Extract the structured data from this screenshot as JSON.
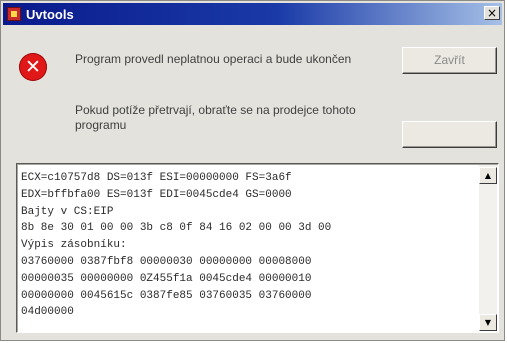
{
  "window": {
    "title": "Uvtools",
    "close_glyph": "×",
    "icon": "app-icon"
  },
  "message": {
    "line1": "Program provedl neplatnou operaci a bude ukončen",
    "line2": "Pokud potíže přetrvají, obraťte se na prodejce tohoto programu",
    "icon": "error-icon",
    "icon_glyph": "✕",
    "icon_color": "#e01818"
  },
  "buttons": {
    "close_label": "Zavřít",
    "details_label": ""
  },
  "details": {
    "lines": [
      "ECX=c10757d8 DS=013f ESI=00000000 FS=3a6f",
      "EDX=bffbfa00 ES=013f EDI=0045cde4 GS=0000",
      "Bajty v CS:EIP",
      "8b 8e 30 01 00 00 3b c8 0f 84 16 02 00 00 3d 00",
      "Výpis zásobníku:",
      "03760000 0387fbf8 00000030 00000000 00008000",
      "00000035 00000000 0Z455f1a 0045cde4 00000010",
      "00000000 0045615c 0387fe85 03760035 03760000",
      "04d00000"
    ],
    "scroll_up_glyph": "▲",
    "scroll_down_glyph": "▼"
  }
}
